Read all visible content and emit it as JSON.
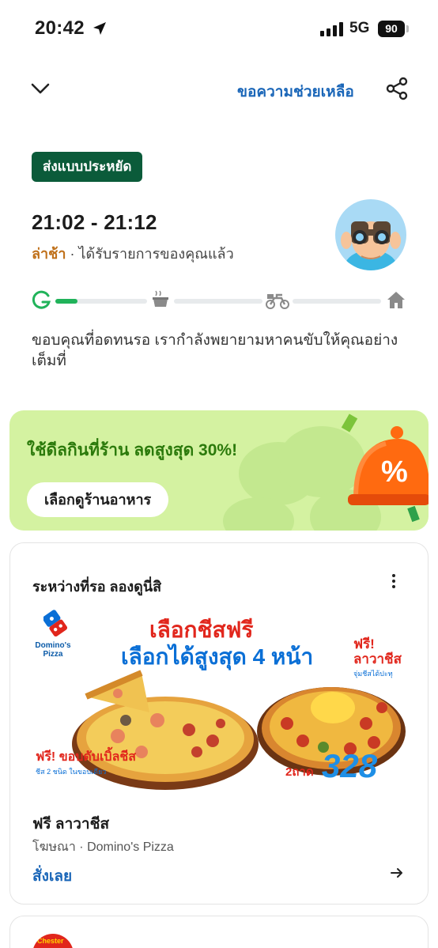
{
  "status_bar": {
    "time": "20:42",
    "network": "5G",
    "battery": "90"
  },
  "nav": {
    "help": "ขอความช่วยเหลือ"
  },
  "badge": "ส่งแบบประหยัด",
  "eta": {
    "time": "21:02 - 21:12",
    "late": "ล่าช้า",
    "status": " · ได้รับรายการของคุณแล้ว"
  },
  "progress": {
    "fraction": 0.08
  },
  "wait_message": "ขอบคุณที่อดทนรอ เรากำลังพยายามหาคนขับให้คุณอย่างเต็มที่",
  "promo": {
    "title": "ใช้ดีลกินที่ร้าน ลดสูงสุด 30%!",
    "button": "เลือกดูร้านอาหาร"
  },
  "ad": {
    "section_title": "ระหว่างที่รอ ลองดูนี่สิ",
    "image": {
      "brand": "Domino's Pizza",
      "headline_1": "เลือกชีสฟรี",
      "headline_2": "เลือกได้สูงสุด 4 หน้า",
      "free_right": "ฟรี! ลาวาชีส",
      "free_right_note": "จุ่มชีสได้ปะทุ",
      "free_left": "ฟรี! ขอบดับเบิ้ลชีส",
      "free_left_note": "ชีส 2 ชนิด ในขอบเดียว",
      "tray": "2ถาด",
      "price": "328"
    },
    "name": "ฟรี ลาวาชีส",
    "sponsor": "โฆษณา · Domino's Pizza",
    "cta": "สั่งเลย"
  },
  "next_card": {
    "logo_text": "Chester"
  },
  "colors": {
    "accent_green": "#0b5b3a",
    "link_blue": "#1a66b8",
    "late_orange": "#c0711b",
    "promo_bg": "#d4f2a1"
  }
}
